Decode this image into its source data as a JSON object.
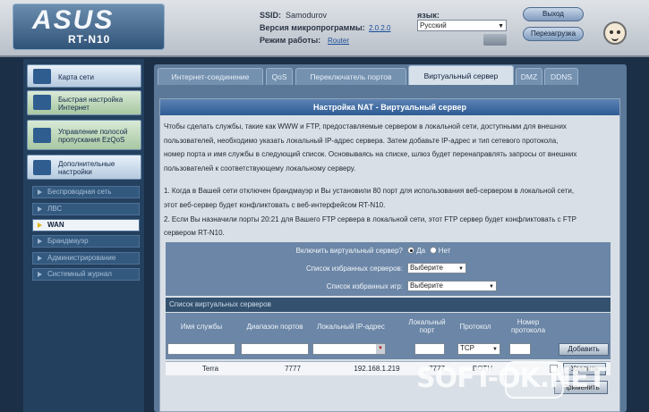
{
  "header": {
    "logo": "ASUS",
    "model": "RT-N10",
    "ssid_label": "SSID:",
    "ssid_value": "Samodurov",
    "firmware_label": "Версия микропрограммы:",
    "firmware_value": "2.0.2.0",
    "mode_label": "Режим работы:",
    "mode_value": "Router",
    "lang_label": "язык:",
    "lang_value": "Русский",
    "logout": "Выход",
    "reboot": "Перезагрузка"
  },
  "sidebar": {
    "main": [
      {
        "label": "Карта сети"
      },
      {
        "label": "Быстрая настройка Интернет"
      },
      {
        "label": "Управление полосой пропускания EzQoS"
      },
      {
        "label": "Дополнительные настройки"
      }
    ],
    "sub": [
      {
        "label": "Беспроводная сеть"
      },
      {
        "label": "ЛВС"
      },
      {
        "label": "WAN"
      },
      {
        "label": "Брандмауэр"
      },
      {
        "label": "Администрирование"
      },
      {
        "label": "Системный журнал"
      }
    ]
  },
  "tabs": [
    {
      "label": "Интернет-соединение"
    },
    {
      "label": "QoS"
    },
    {
      "label": "Переключатель портов"
    },
    {
      "label": "Виртуальный сервер"
    },
    {
      "label": "DMZ"
    },
    {
      "label": "DDNS"
    }
  ],
  "panel": {
    "title": "Настройка NAT - Виртуальный сервер",
    "desc_lines": [
      "Чтобы сделать службы, такие как WWW и FTP, предоставляемые сервером в локальной сети, доступными для внешних",
      "пользователей, необходимо указать локальный IP-адрес сервера. Затем добавьте IP-адрес и тип сетевого протокола,",
      "номер порта и имя службы в следующий список. Основываясь на списке, шлюз будет перенаправлять запросы от внешних",
      "пользователей к соответствующему локальному серверу.",
      "",
      "1. Когда в Вашей сети отключен брандмауэр и Вы установили 80 порт для использования веб-сервером в локальной сети,",
      "этот веб-сервер будет конфликтовать с веб-интерфейсом RT-N10.",
      "2. Если Вы назначили порты 20:21 для Вашего FTP сервера в локальной сети, этот FTP сервер будет конфликтовать с FTP",
      "сервером RT-N10."
    ],
    "enable_label": "Включить виртуальный сервер?",
    "yes": "Да",
    "no": "Нет",
    "fav_servers_label": "Список избранных серверов:",
    "fav_games_label": "Список избранных игр:",
    "select_placeholder": "Выберите",
    "list_title": "Список виртуальных серверов",
    "columns": [
      "Имя службы",
      "Диапазон портов",
      "Локальный IP-адрес",
      "Локальный порт",
      "Протокол",
      "Номер протокола"
    ],
    "protocol_value": "TCP",
    "add": "Добавить",
    "row": {
      "name": "Terra",
      "range": "7777",
      "ip": "192.168.1.219",
      "port": "7777",
      "proto": "BOTH"
    },
    "delete": "Удалить",
    "apply": "Применить"
  },
  "watermark": "SOFT-OK.NET"
}
